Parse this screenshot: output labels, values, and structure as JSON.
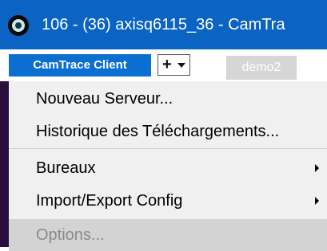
{
  "window": {
    "title": "106 -  (36) axisq6115_36 - CamTra"
  },
  "toolbar": {
    "client_label": "CamTrace Client",
    "add_label": "+",
    "tab_label": "demo2"
  },
  "menu": {
    "items": [
      {
        "label": "Nouveau Serveur...",
        "submenu": false,
        "enabled": true
      },
      {
        "label": "Historique des Téléchargements...",
        "submenu": false,
        "enabled": true
      },
      {
        "label": "Bureaux",
        "submenu": true,
        "enabled": true
      },
      {
        "label": "Import/Export Config",
        "submenu": true,
        "enabled": true
      },
      {
        "label": "Options...",
        "submenu": false,
        "enabled": false
      }
    ]
  },
  "colors": {
    "titlebar": "#0b63c4",
    "client_button": "#0a6fd0",
    "menu_background": "#f0f0f0",
    "highlight": "#d3d3d3"
  }
}
